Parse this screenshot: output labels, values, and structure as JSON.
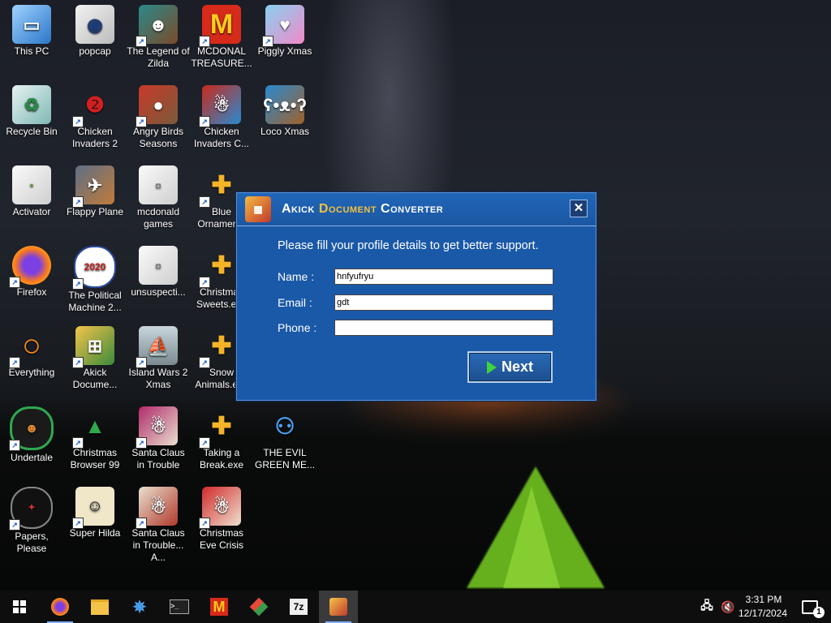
{
  "desktop_icons": [
    {
      "label": "This PC"
    },
    {
      "label": "popcap"
    },
    {
      "label": "The Legend of Zilda"
    },
    {
      "label": "MCDONAL TREASURE..."
    },
    {
      "label": "Piggly Xmas"
    },
    {
      "label": "Recycle Bin"
    },
    {
      "label": "Chicken Invaders 2"
    },
    {
      "label": "Angry Birds Seasons"
    },
    {
      "label": "Chicken Invaders C..."
    },
    {
      "label": "Loco Xmas"
    },
    {
      "label": "Activator"
    },
    {
      "label": "Flappy Plane"
    },
    {
      "label": "mcdonald games"
    },
    {
      "label": "Blue Ornaments"
    },
    {
      "label": "Firefox"
    },
    {
      "label": "The Political Machine 2..."
    },
    {
      "label": "unsuspecti..."
    },
    {
      "label": "Christmas Sweets.exe"
    },
    {
      "label": "Everything"
    },
    {
      "label": "Akick Docume..."
    },
    {
      "label": "Island Wars 2 Xmas"
    },
    {
      "label": "Snow Animals.exe"
    },
    {
      "label": "Undertale"
    },
    {
      "label": "Christmas Browser 99"
    },
    {
      "label": "Santa Claus in Trouble"
    },
    {
      "label": "Taking a Break.exe"
    },
    {
      "label": "THE EVIL GREEN ME..."
    },
    {
      "label": "Papers, Please"
    },
    {
      "label": "Super Hilda"
    },
    {
      "label": "Santa Claus in Trouble... A..."
    },
    {
      "label": "Christmas Eve Crisis"
    }
  ],
  "dialog": {
    "title_part1": "Akick",
    "title_part2": "Document",
    "title_part3": "Converter",
    "close_glyph": "✕",
    "message": "Please fill your profile details to get better support.",
    "name_label": "Name :",
    "name_value": "hnfyufryu",
    "email_label": "Email :",
    "email_value": "gdt",
    "phone_label": "Phone :",
    "phone_value": "",
    "next_label": "Next"
  },
  "taskbar": {
    "time": "3:31 PM",
    "date": "12/17/2024",
    "icons": [
      "windows-start-icon",
      "firefox-icon",
      "file-explorer-icon",
      "network-app-icon",
      "terminal-icon",
      "mcdonalds-icon",
      "colorful-app-icon",
      "7zip-icon",
      "akick-icon"
    ],
    "sevenzip_text": "7z",
    "terminal_text": ">_",
    "notification_count": "1"
  },
  "colors": {
    "dialog_bg": "#1a59a8",
    "title_highlight": "#f0c240",
    "next_arrow": "#3fd33f"
  }
}
